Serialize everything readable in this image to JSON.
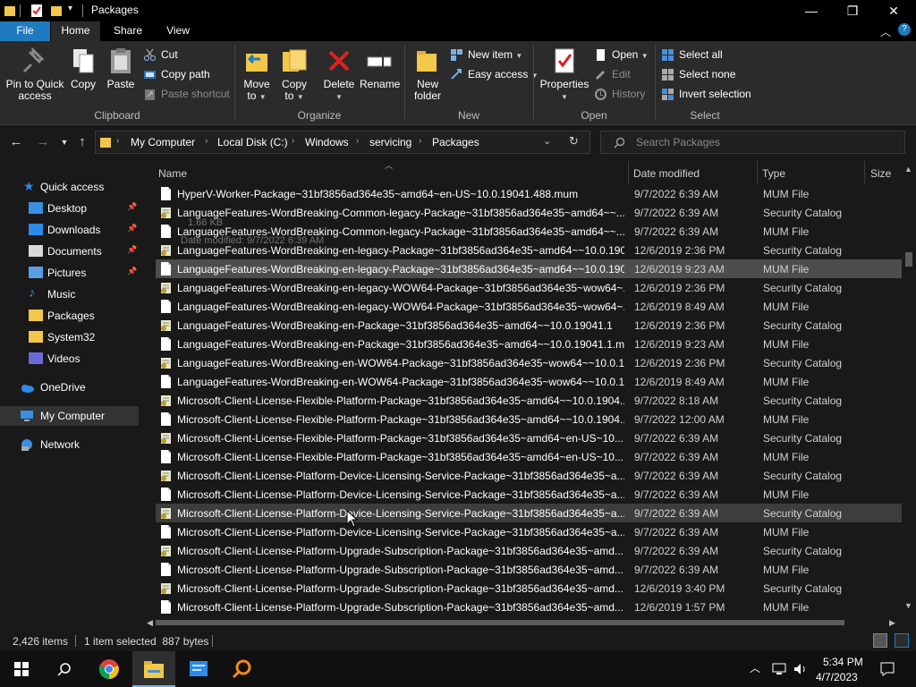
{
  "window": {
    "title": "Packages"
  },
  "tabs": [
    {
      "label": "File"
    },
    {
      "label": "Home"
    },
    {
      "label": "Share"
    },
    {
      "label": "View"
    }
  ],
  "ribbon": {
    "clipboard": {
      "label": "Clipboard",
      "pin_label_1": "Pin to Quick",
      "pin_label_2": "access",
      "copy": "Copy",
      "paste": "Paste",
      "cut": "Cut",
      "copy_path": "Copy path",
      "paste_shortcut": "Paste shortcut"
    },
    "organize": {
      "label": "Organize",
      "move_to_1": "Move",
      "move_to_2": "to",
      "copy_to_1": "Copy",
      "copy_to_2": "to",
      "delete": "Delete",
      "rename": "Rename"
    },
    "new": {
      "label": "New",
      "new_folder_1": "New",
      "new_folder_2": "folder",
      "new_item": "New item",
      "easy_access": "Easy access"
    },
    "open": {
      "label": "Open",
      "properties": "Properties",
      "open": "Open",
      "edit": "Edit",
      "history": "History"
    },
    "select": {
      "label": "Select",
      "select_all": "Select all",
      "select_none": "Select none",
      "invert_selection": "Invert selection"
    }
  },
  "address": {
    "crumbs": [
      "My Computer",
      "Local Disk (C:)",
      "Windows",
      "servicing",
      "Packages"
    ],
    "search_placeholder": "Search Packages"
  },
  "navpane": {
    "quick_access": "Quick access",
    "items": [
      {
        "label": "Desktop",
        "pinned": true,
        "icon": "desktop-icon"
      },
      {
        "label": "Downloads",
        "pinned": true,
        "icon": "downloads-icon"
      },
      {
        "label": "Documents",
        "pinned": true,
        "icon": "documents-icon"
      },
      {
        "label": "Pictures",
        "pinned": true,
        "icon": "pictures-icon"
      },
      {
        "label": "Music",
        "pinned": false,
        "icon": "music-icon"
      },
      {
        "label": "Packages",
        "pinned": false,
        "icon": "folder-icon"
      },
      {
        "label": "System32",
        "pinned": false,
        "icon": "folder-icon"
      },
      {
        "label": "Videos",
        "pinned": false,
        "icon": "videos-icon"
      }
    ],
    "onedrive": "OneDrive",
    "my_computer": "My Computer",
    "network": "Network"
  },
  "columns": {
    "name": "Name",
    "date": "Date modified",
    "type": "Type",
    "size": "Size"
  },
  "drag_tooltip": {
    "size": "1.66 KB",
    "date": "Date modified: 9/7/2022 6:39 AM"
  },
  "files": [
    {
      "name": "HyperV-Worker-Package~31bf3856ad364e35~amd64~en-US~10.0.19041.488.mum",
      "date": "9/7/2022 6:39 AM",
      "type": "MUM File",
      "kind": "mum"
    },
    {
      "name": "LanguageFeatures-WordBreaking-Common-legacy-Package~31bf3856ad364e35~amd64~~...",
      "date": "9/7/2022 6:39 AM",
      "type": "Security Catalog",
      "kind": "cat"
    },
    {
      "name": "LanguageFeatures-WordBreaking-Common-legacy-Package~31bf3856ad364e35~amd64~~...",
      "date": "9/7/2022 6:39 AM",
      "type": "MUM File",
      "kind": "mum"
    },
    {
      "name": "LanguageFeatures-WordBreaking-en-legacy-Package~31bf3856ad364e35~amd64~~10.0.190...",
      "date": "12/6/2019 2:36 PM",
      "type": "Security Catalog",
      "kind": "cat"
    },
    {
      "name": "LanguageFeatures-WordBreaking-en-legacy-Package~31bf3856ad364e35~amd64~~10.0.190...",
      "date": "12/6/2019 9:23 AM",
      "type": "MUM File",
      "kind": "mum",
      "selected": true
    },
    {
      "name": "LanguageFeatures-WordBreaking-en-legacy-WOW64-Package~31bf3856ad364e35~wow64~...",
      "date": "12/6/2019 2:36 PM",
      "type": "Security Catalog",
      "kind": "cat"
    },
    {
      "name": "LanguageFeatures-WordBreaking-en-legacy-WOW64-Package~31bf3856ad364e35~wow64~...",
      "date": "12/6/2019 8:49 AM",
      "type": "MUM File",
      "kind": "mum"
    },
    {
      "name": "LanguageFeatures-WordBreaking-en-Package~31bf3856ad364e35~amd64~~10.0.19041.1",
      "date": "12/6/2019 2:36 PM",
      "type": "Security Catalog",
      "kind": "cat"
    },
    {
      "name": "LanguageFeatures-WordBreaking-en-Package~31bf3856ad364e35~amd64~~10.0.19041.1.m...",
      "date": "12/6/2019 9:23 AM",
      "type": "MUM File",
      "kind": "mum"
    },
    {
      "name": "LanguageFeatures-WordBreaking-en-WOW64-Package~31bf3856ad364e35~wow64~~10.0.1...",
      "date": "12/6/2019 2:36 PM",
      "type": "Security Catalog",
      "kind": "cat"
    },
    {
      "name": "LanguageFeatures-WordBreaking-en-WOW64-Package~31bf3856ad364e35~wow64~~10.0.1...",
      "date": "12/6/2019 8:49 AM",
      "type": "MUM File",
      "kind": "mum"
    },
    {
      "name": "Microsoft-Client-License-Flexible-Platform-Package~31bf3856ad364e35~amd64~~10.0.1904...",
      "date": "9/7/2022 8:18 AM",
      "type": "Security Catalog",
      "kind": "cat"
    },
    {
      "name": "Microsoft-Client-License-Flexible-Platform-Package~31bf3856ad364e35~amd64~~10.0.1904...",
      "date": "9/7/2022 12:00 AM",
      "type": "MUM File",
      "kind": "mum"
    },
    {
      "name": "Microsoft-Client-License-Flexible-Platform-Package~31bf3856ad364e35~amd64~en-US~10....",
      "date": "9/7/2022 6:39 AM",
      "type": "Security Catalog",
      "kind": "cat"
    },
    {
      "name": "Microsoft-Client-License-Flexible-Platform-Package~31bf3856ad364e35~amd64~en-US~10....",
      "date": "9/7/2022 6:39 AM",
      "type": "MUM File",
      "kind": "mum"
    },
    {
      "name": "Microsoft-Client-License-Platform-Device-Licensing-Service-Package~31bf3856ad364e35~a...",
      "date": "9/7/2022 6:39 AM",
      "type": "Security Catalog",
      "kind": "cat"
    },
    {
      "name": "Microsoft-Client-License-Platform-Device-Licensing-Service-Package~31bf3856ad364e35~a...",
      "date": "9/7/2022 6:39 AM",
      "type": "MUM File",
      "kind": "mum"
    },
    {
      "name": "Microsoft-Client-License-Platform-Device-Licensing-Service-Package~31bf3856ad364e35~a...",
      "date": "9/7/2022 6:39 AM",
      "type": "Security Catalog",
      "kind": "cat",
      "hover": true
    },
    {
      "name": "Microsoft-Client-License-Platform-Device-Licensing-Service-Package~31bf3856ad364e35~a...",
      "date": "9/7/2022 6:39 AM",
      "type": "MUM File",
      "kind": "mum"
    },
    {
      "name": "Microsoft-Client-License-Platform-Upgrade-Subscription-Package~31bf3856ad364e35~amd...",
      "date": "9/7/2022 6:39 AM",
      "type": "Security Catalog",
      "kind": "cat"
    },
    {
      "name": "Microsoft-Client-License-Platform-Upgrade-Subscription-Package~31bf3856ad364e35~amd...",
      "date": "9/7/2022 6:39 AM",
      "type": "MUM File",
      "kind": "mum"
    },
    {
      "name": "Microsoft-Client-License-Platform-Upgrade-Subscription-Package~31bf3856ad364e35~amd...",
      "date": "12/6/2019 3:40 PM",
      "type": "Security Catalog",
      "kind": "cat"
    },
    {
      "name": "Microsoft-Client-License-Platform-Upgrade-Subscription-Package~31bf3856ad364e35~amd...",
      "date": "12/6/2019 1:57 PM",
      "type": "MUM File",
      "kind": "mum"
    }
  ],
  "status": {
    "count": "2,426 items",
    "selection": "1 item selected  887 bytes"
  },
  "taskbar": {
    "time": "5:34 PM",
    "date": "4/7/2023"
  },
  "colors": {
    "accent": "#1f7bbf",
    "folder": "#f3c74a",
    "selected_row": "#4d4d4d"
  }
}
